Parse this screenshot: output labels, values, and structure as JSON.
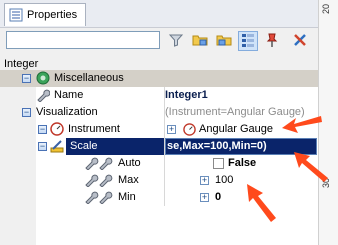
{
  "window": {
    "tab_label": "Properties",
    "ruler_ticks": [
      "20",
      "30"
    ]
  },
  "object_type": "Integer",
  "grid": {
    "rows": [
      {
        "name": "Miscellaneous",
        "value": ""
      },
      {
        "name": "Name",
        "value": "Integer1"
      },
      {
        "name": "Visualization",
        "value": "(Instrument=Angular Gauge)"
      },
      {
        "name": "Instrument",
        "value": "Angular Gauge"
      },
      {
        "name": "Scale",
        "value": "se,Max=100,Min=0)"
      },
      {
        "name": "Auto",
        "value": "False"
      },
      {
        "name": "Max",
        "value": "100"
      },
      {
        "name": "Min",
        "value": "0"
      }
    ]
  },
  "colors": {
    "annotation_arrow": "#ff4a1c",
    "selection": "#0a246a",
    "category_band": "#d4d0c8"
  }
}
